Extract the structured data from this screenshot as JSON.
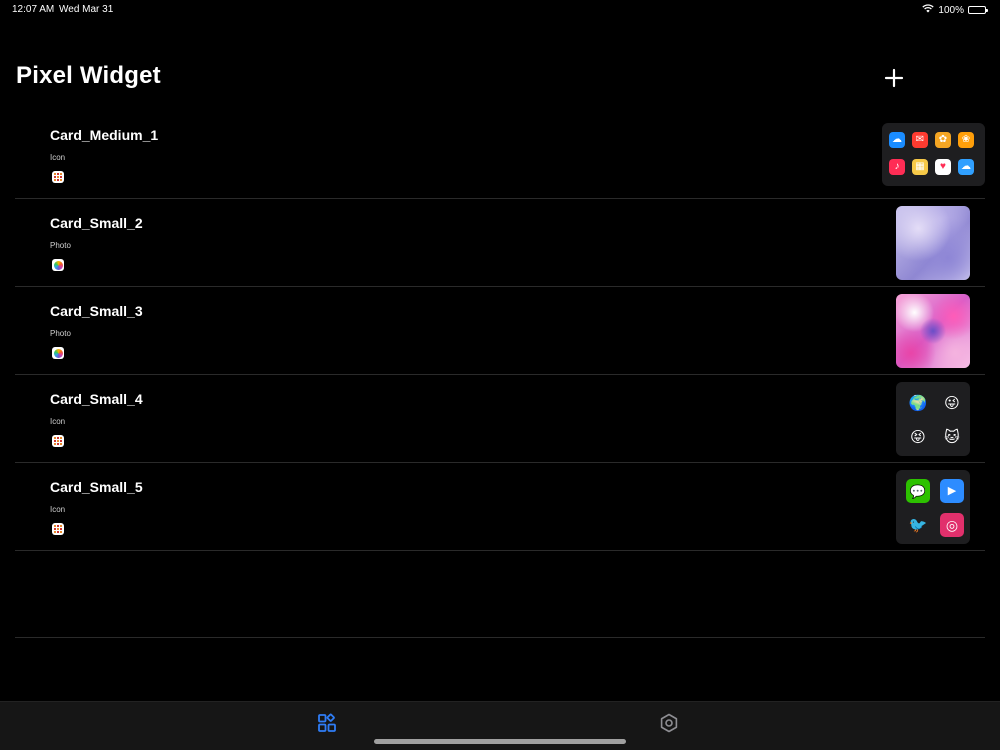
{
  "status_bar": {
    "time": "12:07 AM",
    "date": "Wed Mar 31",
    "battery": "100%"
  },
  "header": {
    "title": "Pixel Widget",
    "add_icon": "plus-icon"
  },
  "widgets": [
    {
      "name": "Card_Medium_1",
      "kind": "Icon",
      "source_icon": "icon-grid",
      "preview": "medium-icon-grid",
      "apps": [
        {
          "icon": "weather-cloud",
          "bg": "#1a8cff",
          "glyph": "☁"
        },
        {
          "icon": "mail-red",
          "bg": "#ff3b30",
          "glyph": "✉"
        },
        {
          "icon": "sunflower",
          "bg": "#f5a623",
          "glyph": "✿"
        },
        {
          "icon": "photos",
          "bg": "#ff9f0a",
          "glyph": "❀"
        },
        {
          "icon": "music",
          "bg": "#ff2d55",
          "glyph": "♪"
        },
        {
          "icon": "notes-yellow",
          "bg": "#f7c948",
          "glyph": "▦"
        },
        {
          "icon": "health-heart",
          "bg": "#ffffff",
          "glyph": "♥"
        },
        {
          "icon": "weather-blue",
          "bg": "#30a0ff",
          "glyph": "☁"
        }
      ]
    },
    {
      "name": "Card_Small_2",
      "kind": "Photo",
      "source_icon": "photos",
      "preview": "photo-purple"
    },
    {
      "name": "Card_Small_3",
      "kind": "Photo",
      "source_icon": "photos",
      "preview": "photo-pink"
    },
    {
      "name": "Card_Small_4",
      "kind": "Icon",
      "source_icon": "icon-grid",
      "preview": "small-icon-grid",
      "apps": [
        {
          "icon": "pixel-globe",
          "bg": "#1e1e20",
          "glyph": "🌍"
        },
        {
          "icon": "pixel-wink-face",
          "bg": "#1e1e20",
          "glyph": "😜"
        },
        {
          "icon": "pixel-tongue-face",
          "bg": "#1e1e20",
          "glyph": "😝"
        },
        {
          "icon": "pixel-cat",
          "bg": "#1e1e20",
          "glyph": "🐱"
        }
      ]
    },
    {
      "name": "Card_Small_5",
      "kind": "Icon",
      "source_icon": "icon-grid",
      "preview": "small-icon-grid",
      "apps": [
        {
          "icon": "wechat",
          "bg": "#2dc100",
          "glyph": "💬"
        },
        {
          "icon": "zoom-video",
          "bg": "#2d8cff",
          "glyph": "▶"
        },
        {
          "icon": "twitter-bird",
          "bg": "#1e1e20",
          "glyph": "🐦"
        },
        {
          "icon": "instagram",
          "bg": "#e1306c",
          "glyph": "◎"
        }
      ]
    }
  ],
  "tab_bar": {
    "tabs": [
      {
        "id": "widgets",
        "icon": "widgets-grid-icon",
        "active": true,
        "color": "#2f7df6"
      },
      {
        "id": "settings",
        "icon": "hexagon-settings-icon",
        "active": false,
        "color": "#8e8e93"
      }
    ]
  }
}
